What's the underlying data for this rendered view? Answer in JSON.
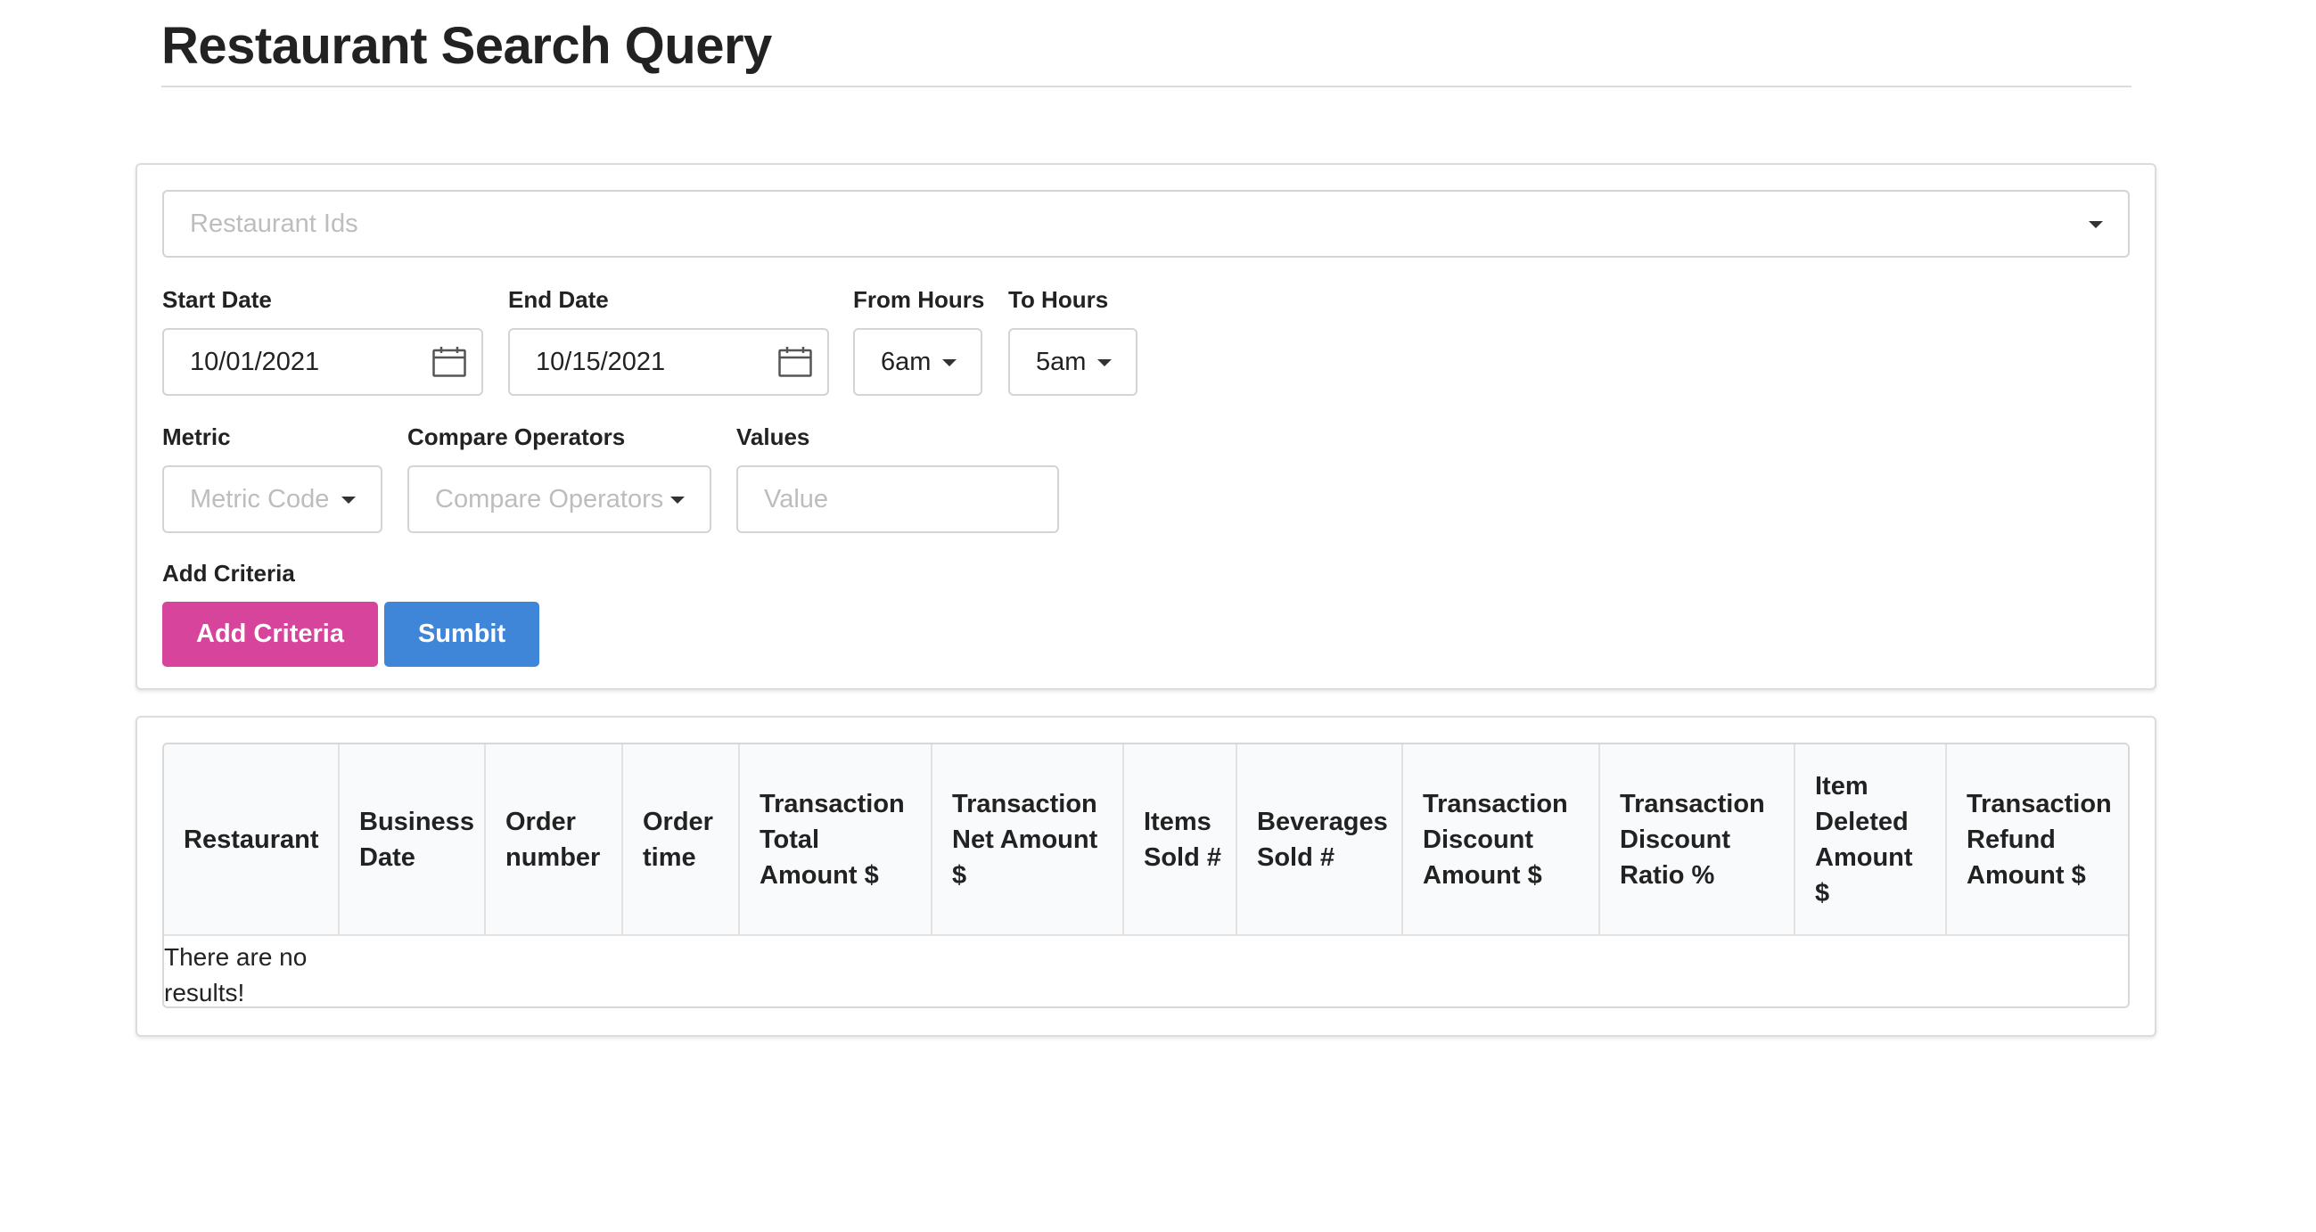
{
  "page": {
    "title": "Restaurant Search Query"
  },
  "query": {
    "restaurant_ids": {
      "placeholder": "Restaurant Ids"
    },
    "start_date": {
      "label": "Start Date",
      "value": "10/01/2021",
      "icon": "calendar-icon"
    },
    "end_date": {
      "label": "End Date",
      "value": "10/15/2021",
      "icon": "calendar-icon"
    },
    "from_hours": {
      "label": "From Hours",
      "value": "6am"
    },
    "to_hours": {
      "label": "To Hours",
      "value": "5am"
    },
    "metric": {
      "label": "Metric",
      "placeholder": "Metric Code"
    },
    "compare_operators": {
      "label": "Compare Operators",
      "placeholder": "Compare Operators"
    },
    "values": {
      "label": "Values",
      "placeholder": "Value"
    },
    "add_criteria_label": "Add Criteria",
    "add_criteria_button": "Add Criteria",
    "submit_button": "Sumbit",
    "colors": {
      "add_criteria": "#d6449b",
      "submit": "#3f86d8"
    }
  },
  "results": {
    "columns": [
      "Restaurant",
      "Business Date",
      "Order number",
      "Order time",
      "Transaction Total Amount $",
      "Transaction Net Amount $",
      "Items Sold #",
      "Beverages Sold #",
      "Transaction Discount Amount $",
      "Transaction Discount Ratio %",
      "Item Deleted Amount $",
      "Transaction Refund Amount $"
    ],
    "empty_message": "There are no results!"
  }
}
